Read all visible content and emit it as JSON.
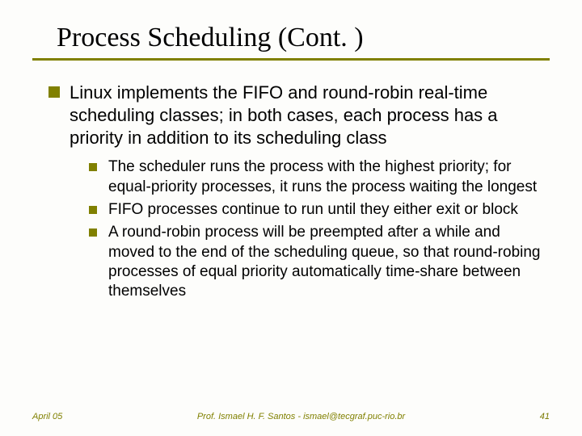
{
  "title": "Process Scheduling (Cont. )",
  "main_bullet": "Linux implements the FIFO and round-robin real-time scheduling classes; in both cases, each process has a priority in addition to its scheduling class",
  "sub_bullets": {
    "b0": "The scheduler runs the process with the highest priority; for equal-priority processes, it runs the process waiting the longest",
    "b1": "FIFO processes continue to run until they either exit or block",
    "b2": "A round-robin process will be preempted after a while and moved to the end of the scheduling queue, so that round-robing processes of equal priority automatically time-share between themselves"
  },
  "footer": {
    "date": "April 05",
    "author": "Prof. Ismael H. F. Santos - ismael@tecgraf.puc-rio.br",
    "page": "41"
  }
}
